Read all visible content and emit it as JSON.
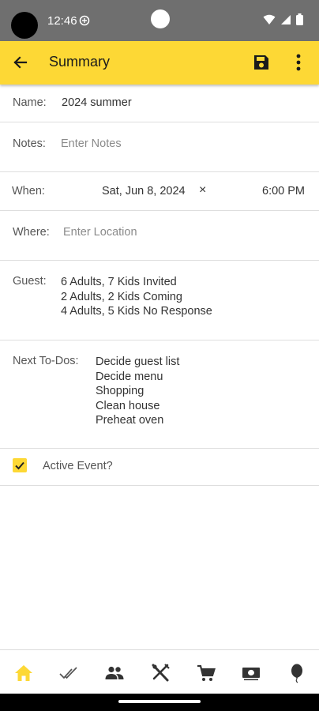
{
  "status_bar": {
    "time": "12:46"
  },
  "app_bar": {
    "title": "Summary"
  },
  "form": {
    "name_label": "Name:",
    "name_value": "2024 summer",
    "notes_label": "Notes:",
    "notes_placeholder": "Enter Notes",
    "when_label": "When:",
    "when_date": "Sat, Jun 8, 2024",
    "when_clear": "×",
    "when_time": "6:00 PM",
    "where_label": "Where:",
    "where_placeholder": "Enter Location",
    "guest_label": "Guest:",
    "guest_lines": [
      "6 Adults, 7 Kids Invited",
      "2 Adults, 2 Kids Coming",
      "4 Adults, 5 Kids No Response"
    ],
    "todos_label": "Next To-Dos:",
    "todos": [
      "Decide guest list",
      "Decide menu",
      "Shopping",
      "Clean house",
      "Preheat oven"
    ],
    "active_label": "Active Event?",
    "active_checked": true
  },
  "bottom_nav": {
    "items": [
      {
        "icon": "home-icon",
        "active": true
      },
      {
        "icon": "double-check-icon",
        "active": false
      },
      {
        "icon": "people-icon",
        "active": false
      },
      {
        "icon": "utensils-icon",
        "active": false
      },
      {
        "icon": "cart-icon",
        "active": false
      },
      {
        "icon": "money-icon",
        "active": false
      },
      {
        "icon": "balloon-icon",
        "active": false
      }
    ]
  },
  "colors": {
    "accent": "#fdd835",
    "status_bar": "#6f6f6f",
    "icon_dark": "#333333"
  }
}
